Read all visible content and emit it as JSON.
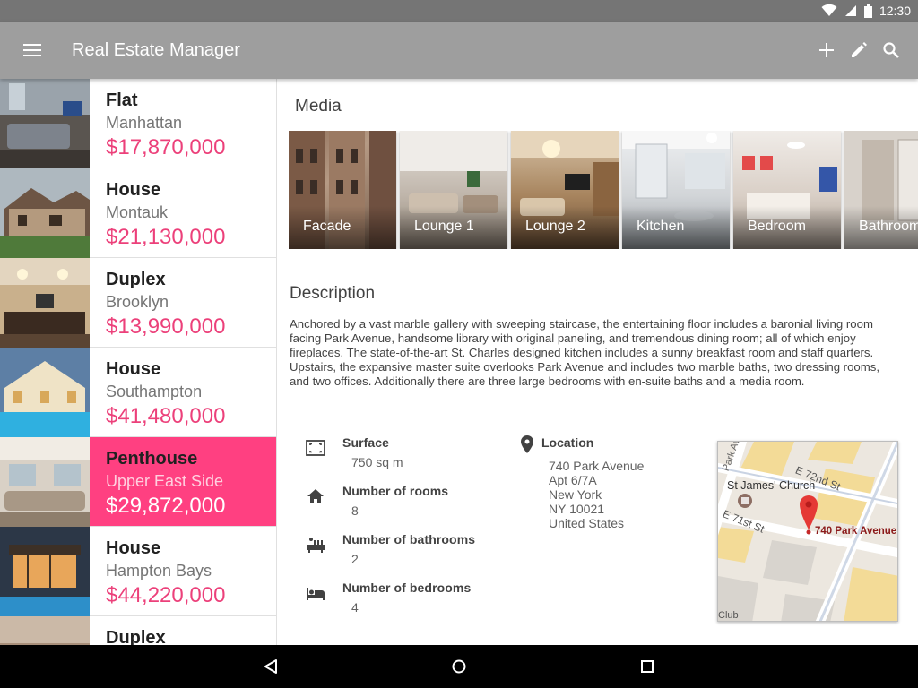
{
  "status_bar": {
    "time": "12:30",
    "icons": [
      "wifi-icon",
      "signal-icon",
      "battery-icon"
    ]
  },
  "app_bar": {
    "title": "Real Estate Manager",
    "icons": [
      "menu-icon",
      "add-icon",
      "edit-icon",
      "search-icon"
    ]
  },
  "colors": {
    "accent": "#ff4081",
    "price": "#ec407a",
    "app_bar": "#9e9e9e",
    "status_bar": "#757575"
  },
  "listings": [
    {
      "type": "Flat",
      "area": "Manhattan",
      "price": "$17,870,000"
    },
    {
      "type": "House",
      "area": "Montauk",
      "price": "$21,130,000"
    },
    {
      "type": "Duplex",
      "area": "Brooklyn",
      "price": "$13,990,000"
    },
    {
      "type": "House",
      "area": "Southampton",
      "price": "$41,480,000"
    },
    {
      "type": "Penthouse",
      "area": "Upper East Side",
      "price": "$29,872,000"
    },
    {
      "type": "House",
      "area": "Hampton Bays",
      "price": "$44,220,000"
    },
    {
      "type": "Duplex",
      "area": "",
      "price": ""
    }
  ],
  "detail": {
    "media_title": "Media",
    "media": [
      "Facade",
      "Lounge 1",
      "Lounge 2",
      "Kitchen",
      "Bedroom",
      "Bathroom"
    ],
    "description_title": "Description",
    "description": "Anchored by a vast marble gallery with sweeping staircase, the entertaining floor includes a baronial living room facing Park Avenue, handsome library with original paneling, and tremendous dining room; all of which enjoy fireplaces. The state-of-the-art St. Charles designed kitchen includes a sunny breakfast room and staff quarters. Upstairs, the expansive master suite overlooks Park Avenue and includes two marble baths, two dressing rooms, and two offices. Additionally there are three large bedrooms with en-suite baths and a media room.",
    "facts": {
      "surface": {
        "label": "Surface",
        "value": "750 sq m"
      },
      "rooms": {
        "label": "Number of rooms",
        "value": "8"
      },
      "bathrooms": {
        "label": "Number of bathrooms",
        "value": "2"
      },
      "bedrooms": {
        "label": "Number of bedrooms",
        "value": "4"
      }
    },
    "location": {
      "label": "Location",
      "lines": [
        "740 Park Avenue",
        "Apt 6/7A",
        "New York",
        "NY 10021",
        "United States"
      ]
    },
    "map": {
      "streets": [
        "E 72nd St",
        "E 71st St",
        "Park Ave"
      ],
      "poi": "St James' Church",
      "marker_label": "740 Park Avenue",
      "edge_label": "Club"
    }
  },
  "nav_bar": {
    "icons": [
      "back-icon",
      "home-icon",
      "recents-icon"
    ]
  }
}
